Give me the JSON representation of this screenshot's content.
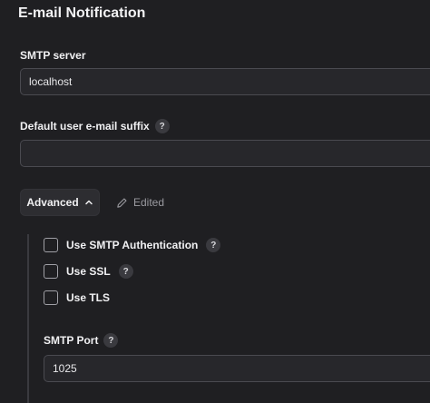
{
  "section": {
    "title": "E-mail Notification"
  },
  "smtp_server": {
    "label": "SMTP server",
    "value": "localhost"
  },
  "suffix": {
    "label": "Default user e-mail suffix",
    "help": "?",
    "value": ""
  },
  "advanced": {
    "label": "Advanced",
    "edited_label": "Edited"
  },
  "checkboxes": [
    {
      "label": "Use SMTP Authentication",
      "help": "?"
    },
    {
      "label": "Use SSL",
      "help": "?"
    },
    {
      "label": "Use TLS"
    }
  ],
  "smtp_port": {
    "label": "SMTP Port",
    "help": "?",
    "value": "1025"
  }
}
